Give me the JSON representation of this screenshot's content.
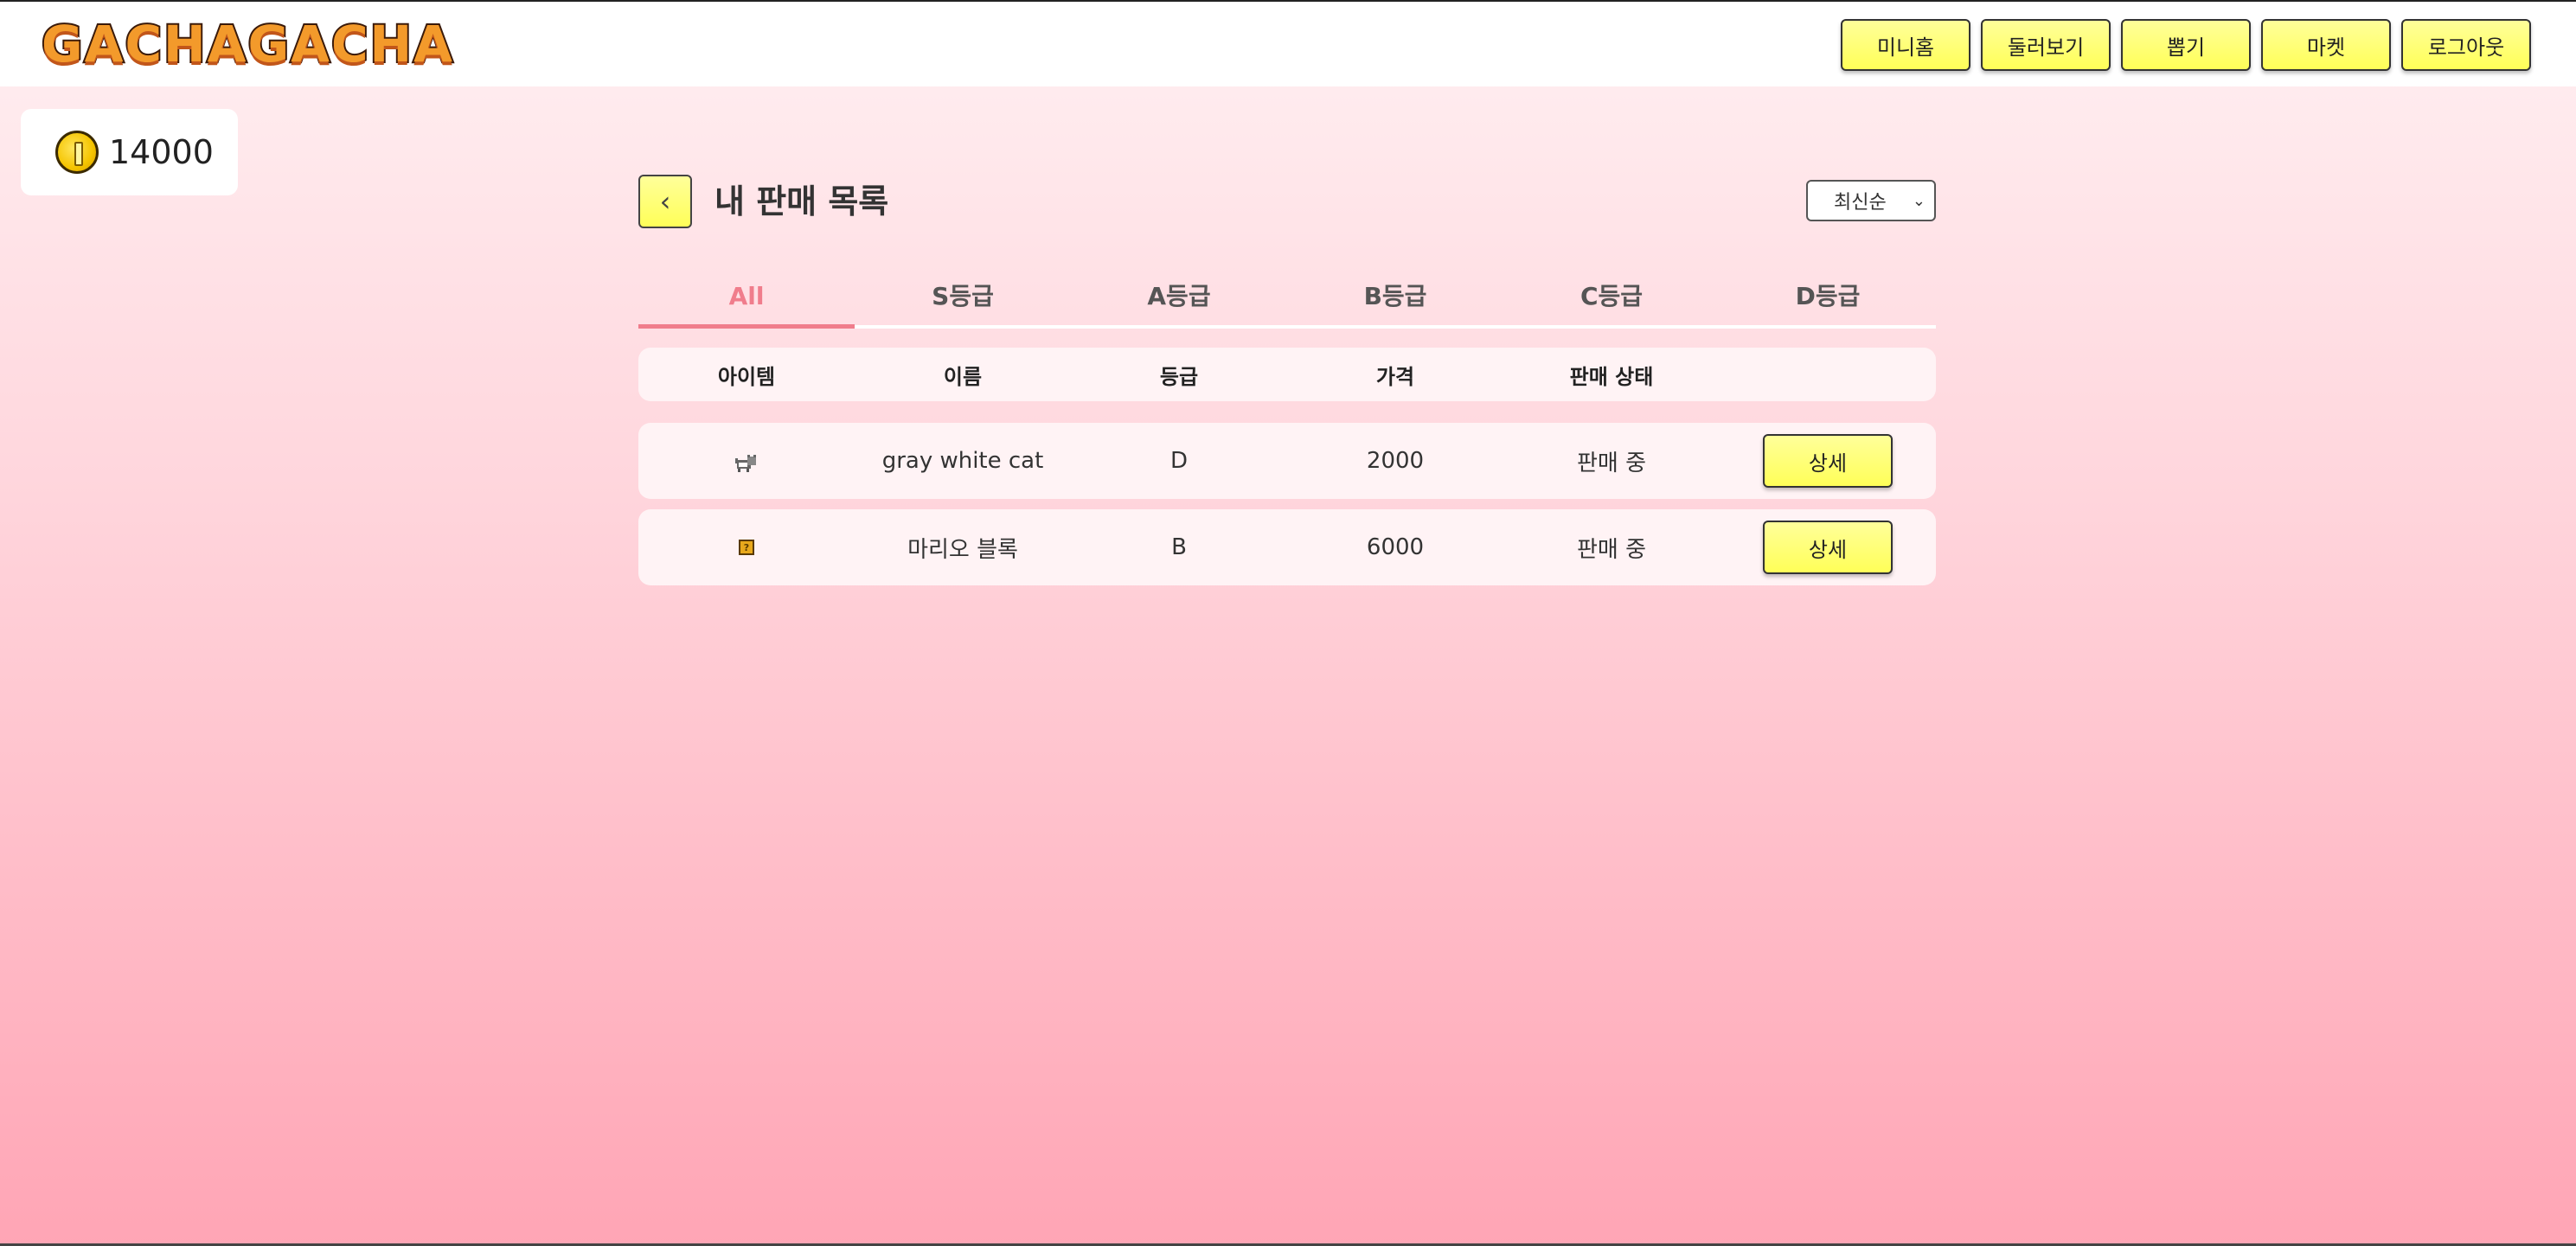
{
  "header": {
    "logo_text": "GACHAGACHA",
    "nav": [
      "미니홈",
      "둘러보기",
      "뽑기",
      "마켓",
      "로그아웃"
    ]
  },
  "wallet": {
    "coins": "14000",
    "icon": "coin-icon"
  },
  "page": {
    "title": "내 판매 목록",
    "back_icon": "chevron-left-icon",
    "sort": {
      "selected": "최신순"
    }
  },
  "tabs": [
    "All",
    "S등급",
    "A등급",
    "B등급",
    "C등급",
    "D등급"
  ],
  "active_tab": "All",
  "table": {
    "headers": [
      "아이템",
      "이름",
      "등급",
      "가격",
      "판매 상태",
      ""
    ],
    "rows": [
      {
        "icon": "cat-icon",
        "name": "gray white cat",
        "grade": "D",
        "price": "2000",
        "status": "판매 중",
        "action": "상세"
      },
      {
        "icon": "block-icon",
        "name": "마리오 블록",
        "grade": "B",
        "price": "6000",
        "status": "판매 중",
        "action": "상세"
      }
    ]
  },
  "colors": {
    "accent": "#f07d8c",
    "button": "#ffff58"
  }
}
